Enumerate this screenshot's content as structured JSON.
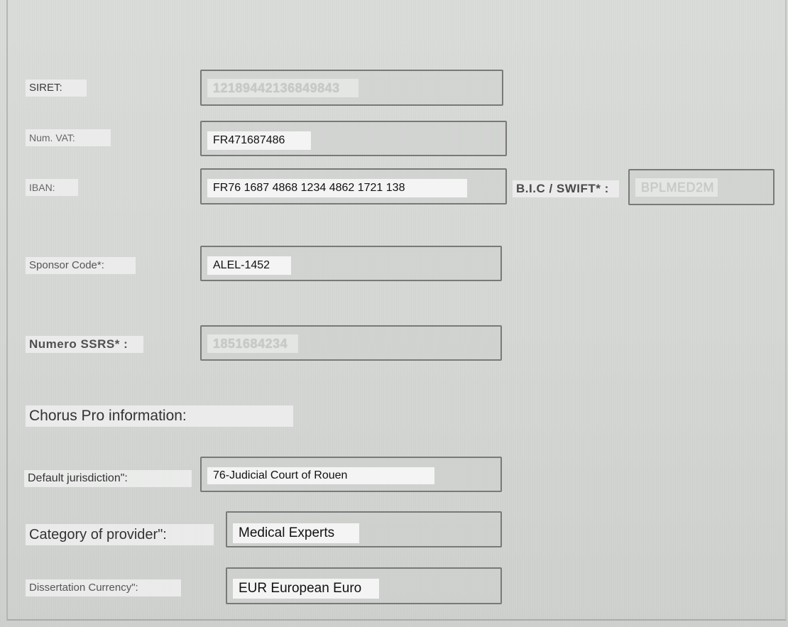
{
  "form": {
    "siret": {
      "label": "SIRET:",
      "value": "12189442136849843"
    },
    "vat": {
      "label": "Num. VAT:",
      "value": "FR471687486"
    },
    "iban": {
      "label": "IBAN:",
      "value": "FR76 1687 4868 1234 4862 1721 138"
    },
    "bic": {
      "label": "B.I.C / SWIFT* :",
      "value": "BPLMED2M"
    },
    "sponsor": {
      "label": "Sponsor Code*:",
      "value": "ALEL-1452"
    },
    "ssrs": {
      "label": "Numero SSRS* :",
      "value": "1851684234"
    },
    "chorus": {
      "heading": "Chorus Pro information:"
    },
    "jurisdiction": {
      "label": "Default jurisdiction\":",
      "value": "76-Judicial Court of Rouen"
    },
    "category": {
      "label": "Category of provider\":",
      "value": "Medical Experts"
    },
    "currency": {
      "label": "Dissertation Currency\":",
      "value": "EUR European Euro"
    }
  }
}
